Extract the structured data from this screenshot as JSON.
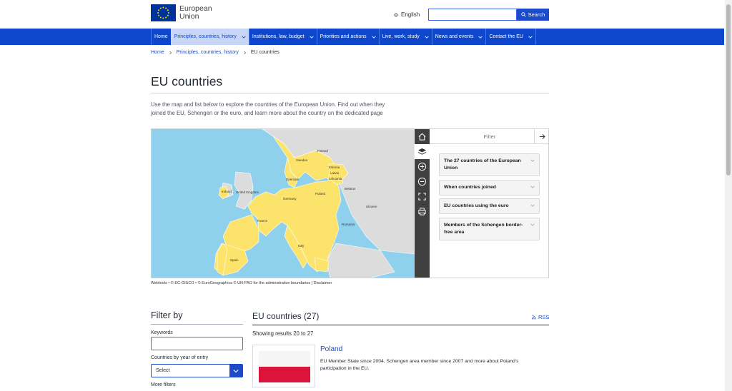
{
  "header": {
    "logo_line1": "European",
    "logo_line2": "Union",
    "language": "English",
    "search_placeholder": "",
    "search_button": "Search"
  },
  "nav": {
    "items": [
      {
        "label": "Home"
      },
      {
        "label": "Principles, countries, history"
      },
      {
        "label": "Institutions, law, budget"
      },
      {
        "label": "Priorities and actions"
      },
      {
        "label": "Live, work, study"
      },
      {
        "label": "News and events"
      },
      {
        "label": "Contact the EU"
      }
    ]
  },
  "breadcrumb": {
    "home": "Home",
    "section": "Principles, countries, history",
    "current": "EU countries"
  },
  "page": {
    "title": "EU countries",
    "intro_line1": "Use the map and list below to explore the countries of the European Union. Find out when they",
    "intro_line2": "joined the EU, Schengen or the euro, and learn more about the country on the dedicated page"
  },
  "map": {
    "labels": {
      "sweden": "Sweden",
      "finland": "Finland",
      "estonia": "Estonia",
      "latvia": "Latvia",
      "lithuania": "Lithuania",
      "belarus": "Belarus",
      "poland": "Poland",
      "germany": "Germany",
      "france": "France",
      "spain": "Spain",
      "italy": "Italy",
      "ireland": "Ireland",
      "uk": "United Kingdom",
      "denmark": "Denmark",
      "romania": "Romania",
      "ukraine": "Ukraine"
    },
    "colors": {
      "eu": "#fce36b",
      "non_eu": "#dcdcdc",
      "sea": "#8fd0ec"
    },
    "panel_title": "Filter",
    "accordions": [
      {
        "label": "The 27 countries of the European Union"
      },
      {
        "label": "When countries joined"
      },
      {
        "label": "EU countries using the euro"
      },
      {
        "label": "Members of the Schengen border-free area"
      }
    ],
    "attribution": "Webtools • © EC-GISCO • © EuroGeographics © UN-FAO for the administrative boundaries | Disclaimer"
  },
  "filter": {
    "title": "Filter by",
    "keywords_label": "Keywords",
    "keywords_value": "",
    "year_label": "Countries by year of entry",
    "year_selected": "Select",
    "more_filters": "More filters"
  },
  "list": {
    "title": "EU countries (27)",
    "rss": "RSS",
    "results": "Showing results 20 to 27",
    "items": [
      {
        "title": "Poland",
        "description_line1": "EU Member State since 2004, Schengen area member since 2007 and more about Poland's",
        "description_line2": "participation in the EU."
      }
    ]
  }
}
